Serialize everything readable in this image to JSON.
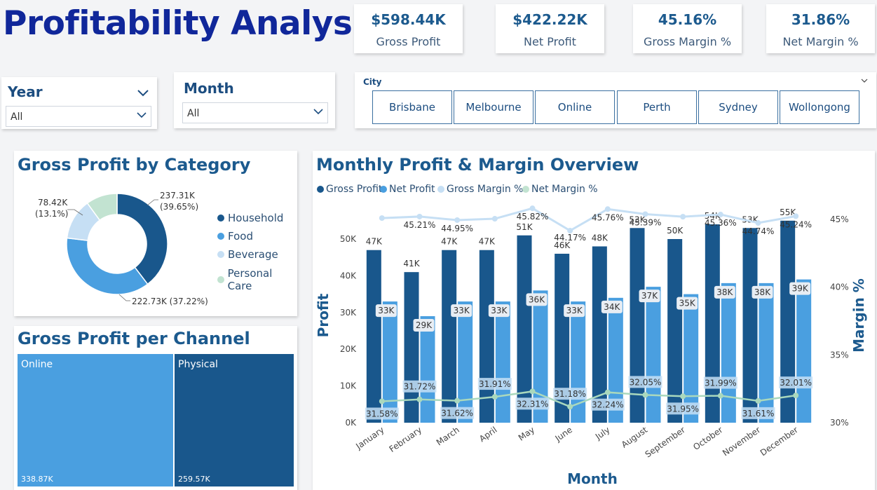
{
  "title": "Profitability Analysis",
  "kpis": [
    {
      "value": "$598.44K",
      "label": "Gross Profit"
    },
    {
      "value": "$422.22K",
      "label": "Net Profit"
    },
    {
      "value": "45.16%",
      "label": "Gross Margin %"
    },
    {
      "value": "31.86%",
      "label": "Net Margin %"
    }
  ],
  "filters": {
    "year": {
      "label": "Year",
      "selected": "All"
    },
    "month": {
      "label": "Month",
      "selected": "All"
    },
    "city": {
      "label": "City",
      "options": [
        "Brisbane",
        "Melbourne",
        "Online",
        "Perth",
        "Sydney",
        "Wollongong"
      ]
    }
  },
  "colors": {
    "dark": "#19578c",
    "mid": "#4a9fe0",
    "light": "#c6dff4",
    "mint": "#c2e3d1",
    "title": "#10279a"
  },
  "chart_data": [
    {
      "type": "pie",
      "title": "Gross Profit by Category",
      "categories": [
        "Household",
        "Food",
        "Beverage",
        "Personal Care"
      ],
      "values": [
        237.31,
        222.73,
        78.42,
        60.0
      ],
      "labels": [
        "237.31K\n(39.65%)",
        "222.73K (37.22%)",
        "78.42K\n(13.1%)",
        ""
      ],
      "legend": "right"
    },
    {
      "type": "heatmap",
      "title": "Gross Profit per Channel",
      "categories": [
        "Online",
        "Physical"
      ],
      "values": [
        338.87,
        259.57
      ],
      "value_labels": [
        "338.87K",
        "259.57K"
      ]
    },
    {
      "type": "bar",
      "title": "Monthly Profit & Margin Overview",
      "xlabel": "Month",
      "ylabel": "Profit",
      "y2label": "Margin %",
      "categories": [
        "January",
        "February",
        "March",
        "April",
        "May",
        "June",
        "July",
        "August",
        "September",
        "October",
        "November",
        "December"
      ],
      "ylim": [
        0,
        55000
      ],
      "yticks": [
        "0K",
        "10K",
        "20K",
        "30K",
        "40K",
        "50K"
      ],
      "y2lim": [
        30,
        45
      ],
      "y2ticks": [
        "30%",
        "35%",
        "40%",
        "45%"
      ],
      "legend": "top-left",
      "series": [
        {
          "name": "Gross Profit",
          "kind": "bar",
          "values": [
            47000,
            41000,
            47000,
            47000,
            51000,
            46000,
            48000,
            53000,
            50000,
            54000,
            53000,
            55000
          ],
          "labels": [
            "47K",
            "41K",
            "47K",
            "47K",
            "51K",
            "46K",
            "48K",
            "53K",
            "50K",
            "54K",
            "53K",
            "55K"
          ]
        },
        {
          "name": "Net Profit",
          "kind": "bar",
          "values": [
            33000,
            29000,
            33000,
            33000,
            36000,
            33000,
            34000,
            37000,
            35000,
            38000,
            38000,
            39000
          ],
          "labels": [
            "33K",
            "29K",
            "33K",
            "33K",
            "36K",
            "33K",
            "34K",
            "37K",
            "35K",
            "38K",
            "38K",
            "39K"
          ]
        },
        {
          "name": "Gross Margin %",
          "kind": "line",
          "values": [
            45.1,
            45.21,
            44.95,
            45.05,
            45.82,
            44.17,
            45.76,
            45.39,
            45.2,
            45.36,
            44.74,
            45.24
          ],
          "labels": [
            "",
            "45.21%",
            "44.95%",
            "",
            "45.82%",
            "44.17%",
            "45.76%",
            "45.39%",
            "",
            "45.36%",
            "44.74%",
            "45.24%"
          ]
        },
        {
          "name": "Net Margin %",
          "kind": "line",
          "values": [
            31.58,
            31.72,
            31.62,
            31.91,
            32.31,
            31.18,
            32.24,
            32.05,
            31.95,
            31.99,
            31.61,
            32.01
          ],
          "labels": [
            "31.58%",
            "31.72%",
            "31.62%",
            "31.91%",
            "32.31%",
            "31.18%",
            "32.24%",
            "32.05%",
            "31.95%",
            "31.99%",
            "31.61%",
            "32.01%"
          ]
        }
      ]
    }
  ]
}
